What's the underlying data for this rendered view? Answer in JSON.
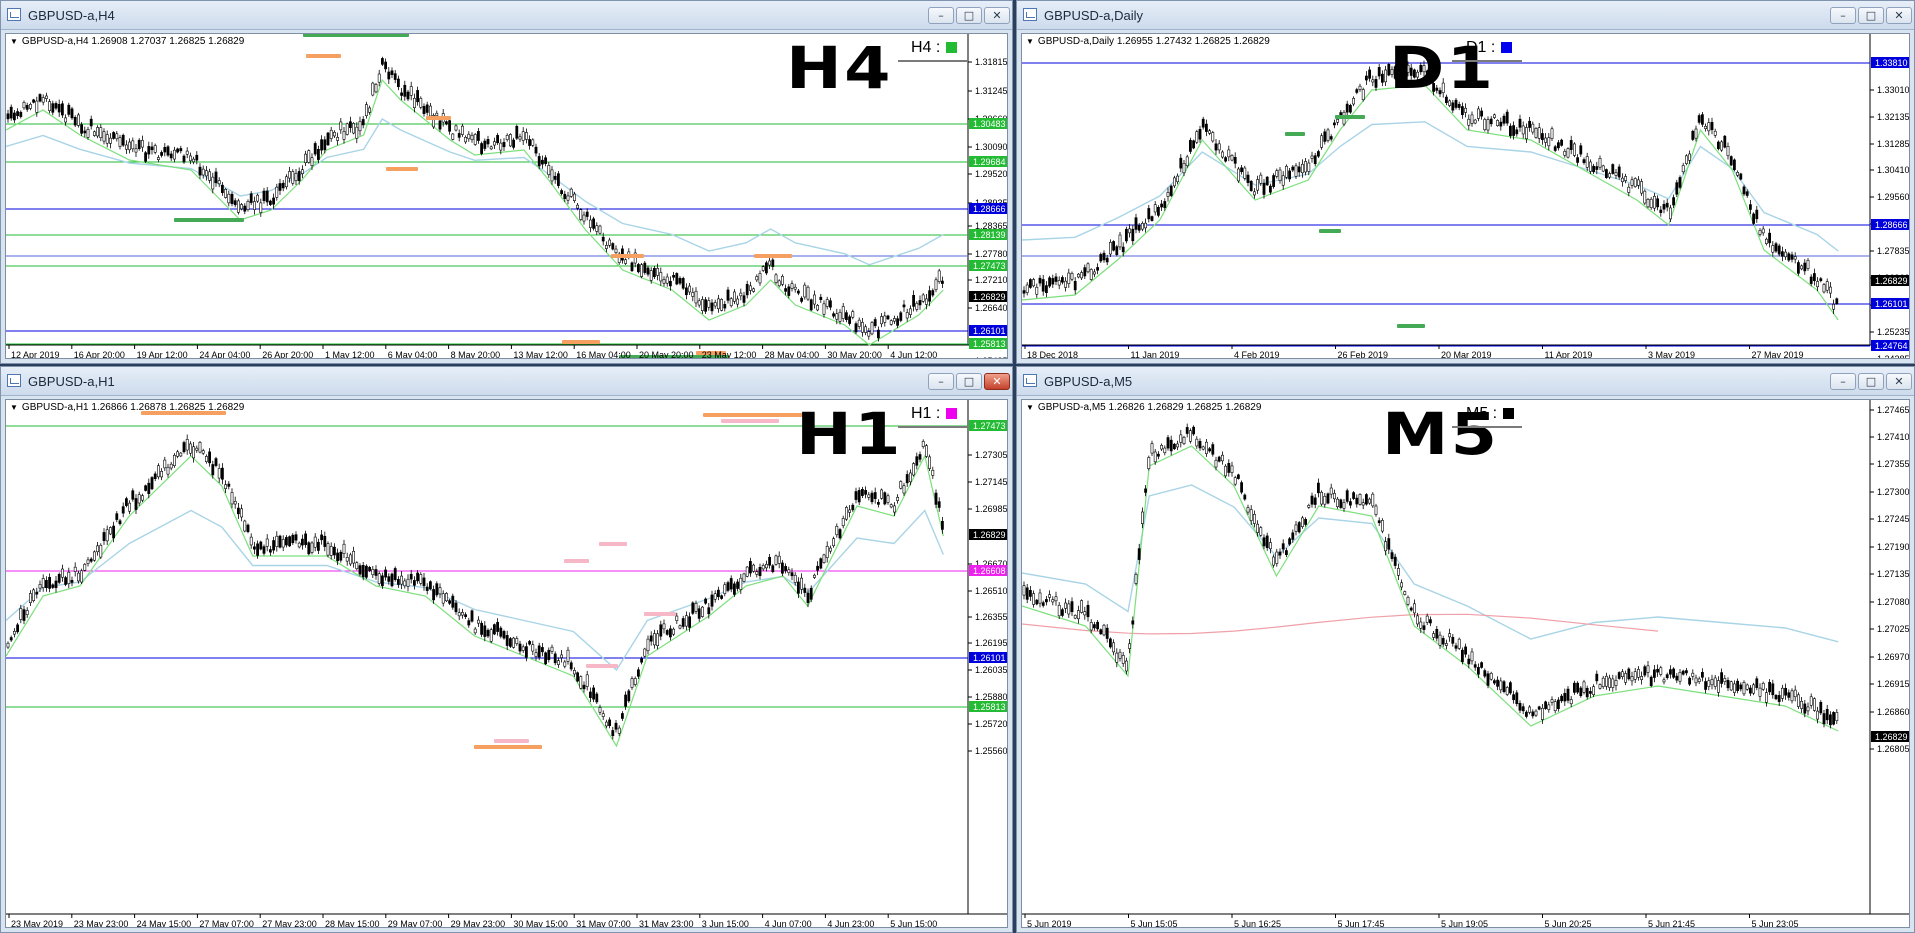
{
  "windows": {
    "h4": {
      "title": "GBPUSD-a,H4",
      "info": "GBPUSD-a,H4  1.26908 1.27037 1.26825 1.26829",
      "big_label": "H4",
      "tf_label": "H4 :",
      "tf_color": "#22bb33",
      "price_ticks": [
        "1.31815",
        "1.31245",
        "1.30660",
        "1.30090",
        "1.29520",
        "1.28935",
        "1.28365",
        "1.27780",
        "1.27210",
        "1.26640",
        "1.25485"
      ],
      "price_tags": [
        {
          "text": "1.30483",
          "color": "#22bb33"
        },
        {
          "text": "1.29684",
          "color": "#22bb33"
        },
        {
          "text": "1.28666",
          "color": "#0000dd"
        },
        {
          "text": "1.28139",
          "color": "#22bb33"
        },
        {
          "text": "1.27473",
          "color": "#22bb33"
        },
        {
          "text": "1.26829",
          "color": "#000000"
        },
        {
          "text": "1.26101",
          "color": "#0000dd"
        },
        {
          "text": "1.25813",
          "color": "#22bb33"
        }
      ],
      "time_ticks": [
        "12 Apr 2019",
        "16 Apr 20:00",
        "19 Apr 12:00",
        "24 Apr 04:00",
        "26 Apr 20:00",
        "1 May 12:00",
        "6 May 04:00",
        "8 May 20:00",
        "13 May 12:00",
        "16 May 04:00",
        "20 May 20:00",
        "23 May 12:00",
        "28 May 04:00",
        "30 May 20:00",
        "4 Jun 12:00"
      ]
    },
    "d1": {
      "title": "GBPUSD-a,Daily",
      "info": "GBPUSD-a,Daily  1.26955 1.27432 1.26825 1.26829",
      "big_label": "D1",
      "tf_label": "D1 :",
      "tf_color": "#0000ee",
      "price_ticks": [
        "1.33010",
        "1.32135",
        "1.31285",
        "1.30410",
        "1.29560",
        "1.28685",
        "1.27835",
        "1.26960",
        "1.26110",
        "1.25235",
        "1.24385"
      ],
      "price_tags": [
        {
          "text": "1.33810",
          "color": "#0000dd"
        },
        {
          "text": "1.28666",
          "color": "#0000dd"
        },
        {
          "text": "1.26829",
          "color": "#000000"
        },
        {
          "text": "1.26101",
          "color": "#0000dd"
        },
        {
          "text": "1.24764",
          "color": "#0000dd"
        }
      ],
      "time_ticks": [
        "18 Dec 2018",
        "11 Jan 2019",
        "4 Feb 2019",
        "26 Feb 2019",
        "20 Mar 2019",
        "11 Apr 2019",
        "3 May 2019",
        "27 May 2019"
      ]
    },
    "h1": {
      "title": "GBPUSD-a,H1",
      "info": "GBPUSD-a,H1  1.26866 1.26878 1.26825 1.26829",
      "big_label": "H1",
      "tf_label": "H1 :",
      "tf_color": "#ee00ee",
      "price_ticks": [
        "1.27305",
        "1.27145",
        "1.26985",
        "1.26670",
        "1.26510",
        "1.26355",
        "1.26195",
        "1.26035",
        "1.25880",
        "1.25720",
        "1.25560"
      ],
      "price_tags": [
        {
          "text": "1.27473",
          "color": "#22bb33"
        },
        {
          "text": "1.26829",
          "color": "#000000"
        },
        {
          "text": "1.26608",
          "color": "#ee22ee"
        },
        {
          "text": "1.26101",
          "color": "#0000dd"
        },
        {
          "text": "1.25813",
          "color": "#22bb33"
        }
      ],
      "time_ticks": [
        "23 May 2019",
        "23 May 23:00",
        "24 May 15:00",
        "27 May 07:00",
        "27 May 23:00",
        "28 May 15:00",
        "29 May 07:00",
        "29 May 23:00",
        "30 May 15:00",
        "31 May 07:00",
        "31 May 23:00",
        "3 Jun 15:00",
        "4 Jun 07:00",
        "4 Jun 23:00",
        "5 Jun 15:00"
      ]
    },
    "m5": {
      "title": "GBPUSD-a,M5",
      "info": "GBPUSD-a,M5  1.26826 1.26829 1.26825 1.26829",
      "big_label": "M5",
      "tf_label": "M5 :",
      "tf_color": "#000000",
      "price_ticks": [
        "1.27465",
        "1.27410",
        "1.27355",
        "1.27300",
        "1.27245",
        "1.27190",
        "1.27135",
        "1.27080",
        "1.27025",
        "1.26970",
        "1.26915",
        "1.26860",
        "1.26805"
      ],
      "price_tags": [
        {
          "text": "1.26829",
          "color": "#000000"
        }
      ],
      "time_ticks": [
        "5 Jun 2019",
        "5 Jun 15:05",
        "5 Jun 16:25",
        "5 Jun 17:45",
        "5 Jun 19:05",
        "5 Jun 20:25",
        "5 Jun 21:45",
        "5 Jun 23:05"
      ]
    }
  },
  "colors": {
    "candle": "#000000",
    "ma_fast": "#7be07b",
    "ma_slow": "#a8d4e6",
    "ma_m5": "#f0a0a8",
    "support_green": "#22bb33",
    "level_blue": "#0000dd",
    "zone_orange": "#f5a060",
    "zone_pink": "#f6b8c6",
    "zone_green": "#44aa55"
  }
}
